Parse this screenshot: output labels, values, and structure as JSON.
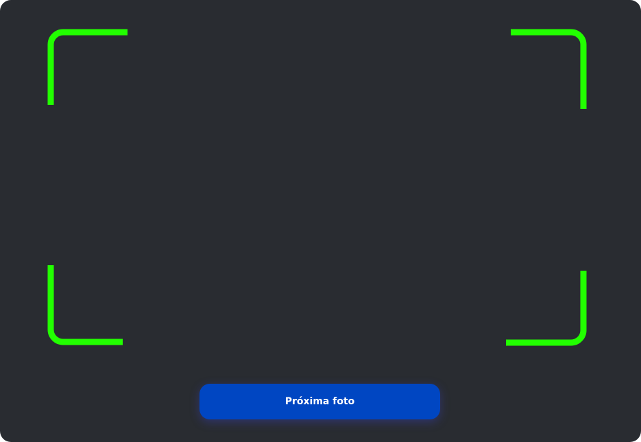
{
  "camera": {
    "guide_color": "#22FF00",
    "background_color": "#292C31"
  },
  "actions": {
    "next_photo_label": "Próxima foto",
    "button_color": "#0046C2"
  }
}
